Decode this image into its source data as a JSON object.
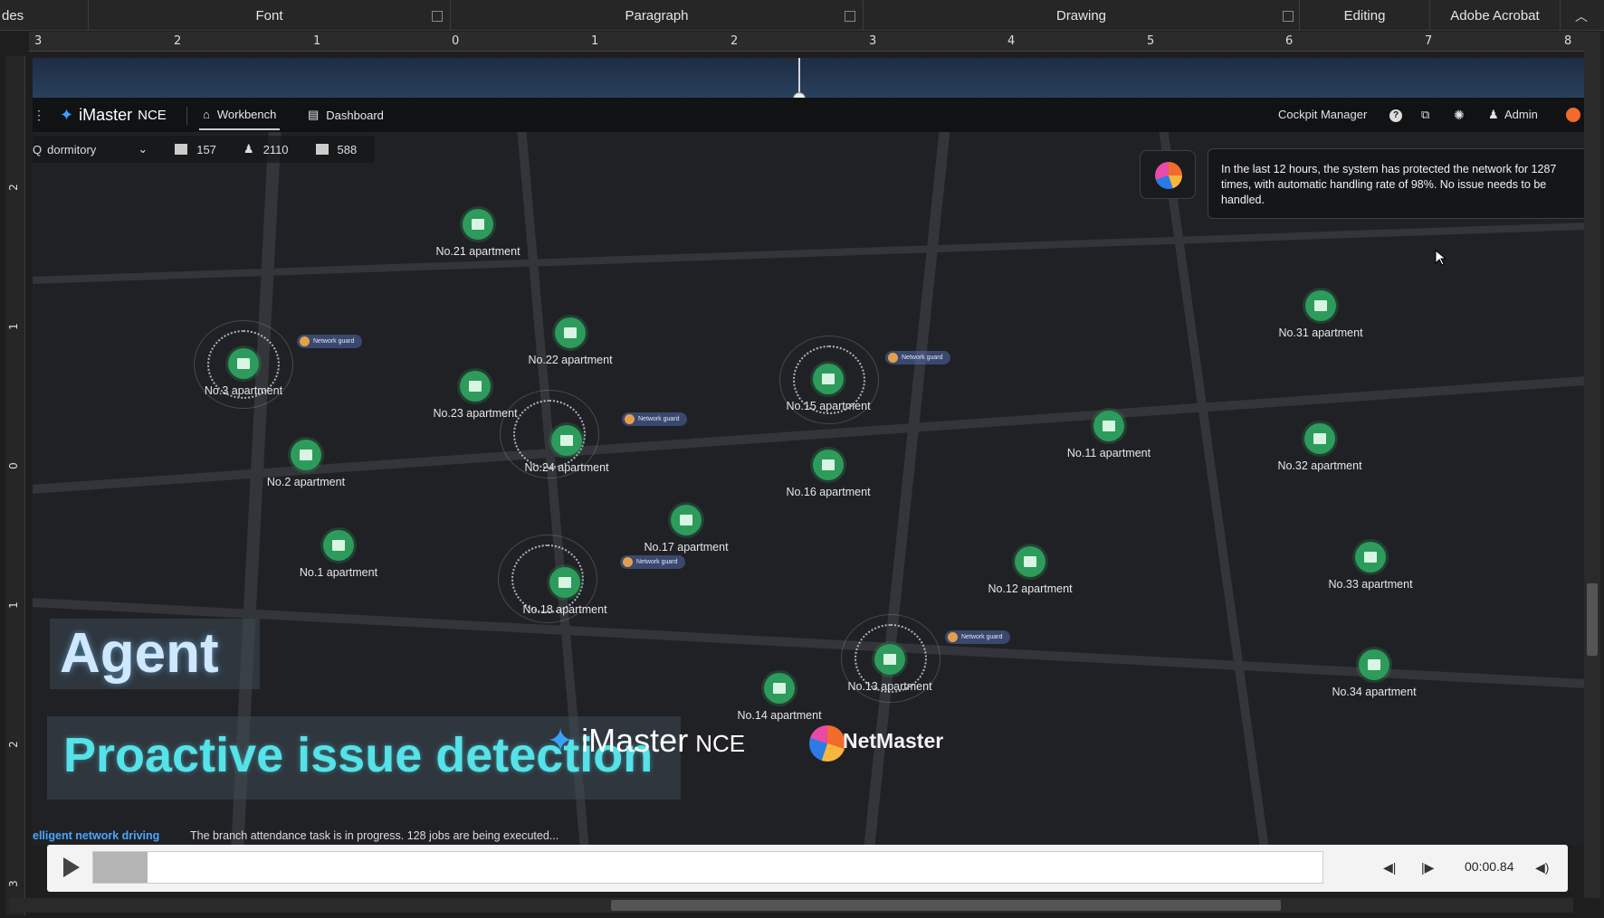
{
  "ribbon": {
    "groups": [
      "des",
      "Font",
      "Paragraph",
      "Drawing",
      "Editing",
      "Adobe Acrobat"
    ]
  },
  "ruler": {
    "h_numbers": [
      "3",
      "2",
      "1",
      "0",
      "1",
      "2",
      "3",
      "4",
      "5",
      "6",
      "7",
      "8"
    ],
    "v_numbers": [
      "2",
      "1",
      "0",
      "1",
      "2",
      "3"
    ]
  },
  "app": {
    "brand": "iMaster",
    "brand_suffix": "NCE",
    "tabs": [
      {
        "label": "Workbench",
        "active": true
      },
      {
        "label": "Dashboard",
        "active": false
      }
    ],
    "cockpit": "Cockpit Manager",
    "user": "Admin"
  },
  "search": {
    "value": "dormitory"
  },
  "stats": {
    "buildings": "157",
    "users": "2110",
    "devices": "588"
  },
  "notice": {
    "text": "In the last 12 hours, the system has protected the network for 1287 times, with automatic handling rate of 98%. No issue needs to be handled."
  },
  "apartments": [
    {
      "label": "No.21 apartment"
    },
    {
      "label": "No.22 apartment"
    },
    {
      "label": "No.3 apartment"
    },
    {
      "label": "No.23 apartment"
    },
    {
      "label": "No.24 apartment"
    },
    {
      "label": "No.2 apartment"
    },
    {
      "label": "No.1 apartment"
    },
    {
      "label": "No.17 apartment"
    },
    {
      "label": "No.18 apartment"
    },
    {
      "label": "No.15 apartment"
    },
    {
      "label": "No.16 apartment"
    },
    {
      "label": "No.14 apartment"
    },
    {
      "label": "No.13 apartment"
    },
    {
      "label": "No.11 apartment"
    },
    {
      "label": "No.12 apartment"
    },
    {
      "label": "No.31 apartment"
    },
    {
      "label": "No.32 apartment"
    },
    {
      "label": "No.33 apartment"
    },
    {
      "label": "No.34 apartment"
    }
  ],
  "guard_label": "Network guard",
  "overlay": {
    "agent": "Agent",
    "headline": "Proactive issue detection",
    "logo1": "iMaster",
    "logo1_suffix": "NCE",
    "logo2": "NetMaster"
  },
  "bottom": {
    "prefix": "elligent network driving",
    "message": "The branch attendance task is in progress. 128 jobs are being executed..."
  },
  "media": {
    "time": "00:00.84",
    "progress": 0.04
  }
}
